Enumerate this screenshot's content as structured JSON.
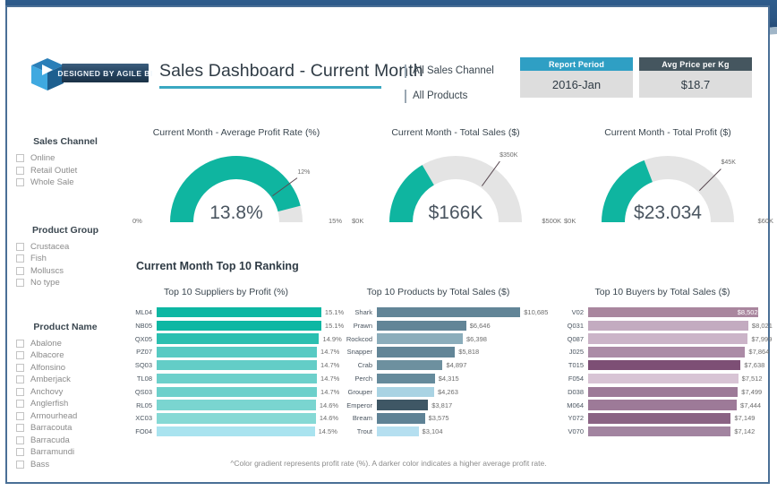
{
  "header": {
    "logo_text": "Designed by Agile BI",
    "logo_icon": "cube-logo-icon",
    "title": "Sales Dashboard - Current Month",
    "slicer_summary": [
      {
        "label": "All Sales Channel"
      },
      {
        "label": "All Products"
      }
    ],
    "kpis": [
      {
        "name": "report-period",
        "label": "Report Period",
        "value": "2016-Jan",
        "header_color": "#2f9fc4"
      },
      {
        "name": "avg-price-per-kg",
        "label": "Avg Price per Kg",
        "value": "$18.7",
        "header_color": "#45565f"
      }
    ]
  },
  "filters": [
    {
      "title": "Sales Channel",
      "items": [
        {
          "label": "Online",
          "checked": false
        },
        {
          "label": "Retail Outlet",
          "checked": false
        },
        {
          "label": "Whole Sale",
          "checked": false
        }
      ]
    },
    {
      "title": "Product Group",
      "items": [
        {
          "label": "Crustacea",
          "checked": false
        },
        {
          "label": "Fish",
          "checked": false
        },
        {
          "label": "Molluscs",
          "checked": false
        },
        {
          "label": "No type",
          "checked": false
        }
      ]
    },
    {
      "title": "Product Name",
      "items": [
        {
          "label": "Abalone",
          "checked": false
        },
        {
          "label": "Albacore",
          "checked": false
        },
        {
          "label": "Alfonsino",
          "checked": false
        },
        {
          "label": "Amberjack",
          "checked": false
        },
        {
          "label": "Anchovy",
          "checked": false
        },
        {
          "label": "Anglerfish",
          "checked": false
        },
        {
          "label": "Armourhead",
          "checked": false
        },
        {
          "label": "Barracouta",
          "checked": false
        },
        {
          "label": "Barracuda",
          "checked": false
        },
        {
          "label": "Barramundi",
          "checked": false
        },
        {
          "label": "Bass",
          "checked": false
        }
      ]
    }
  ],
  "section_title": "Current Month Top 10 Ranking",
  "footnote": "^Color gradient represents profit rate (%). A darker color indicates a higher average profit rate.",
  "colors": {
    "banner": "#2b5480",
    "teal": "#0fb5a0",
    "gauge_track": "#e4e4e4",
    "title_rule": "#3aa8c1",
    "frame": "#4a6f96"
  },
  "chart_data": [
    {
      "type": "gauge",
      "name": "average-profit-rate-gauge",
      "title": "Current Month - Average Profit Rate (%)",
      "value": 13.8,
      "value_label": "13.8%",
      "min": 0,
      "max": 15,
      "min_label": "0%",
      "max_label": "15%",
      "target": 12,
      "target_label": "12%",
      "fill_color": "#0fb5a0",
      "track_color": "#e4e4e4"
    },
    {
      "type": "gauge",
      "name": "total-sales-gauge",
      "title": "Current Month - Total Sales ($)",
      "value": 166,
      "value_label": "$166K",
      "min": 0,
      "max": 500,
      "min_label": "$0K",
      "max_label": "$500K",
      "target": 350,
      "target_label": "$350K",
      "fill_color": "#0fb5a0",
      "track_color": "#e4e4e4"
    },
    {
      "type": "gauge",
      "name": "total-profit-gauge",
      "title": "Current Month - Total Profit ($)",
      "value": 23.034,
      "value_label": "$23.034",
      "min": 0,
      "max": 60,
      "min_label": "$0K",
      "max_label": "$60K",
      "target": 45,
      "target_label": "$45K",
      "fill_color": "#0fb5a0",
      "track_color": "#e4e4e4"
    },
    {
      "type": "bar",
      "name": "top-suppliers-by-profit",
      "title": "Top 10 Suppliers by Profit (%)",
      "orientation": "horizontal",
      "xlabel": "",
      "ylabel": "",
      "axis_max": 15.6,
      "label_inside": false,
      "categories": [
        "ML04",
        "NB05",
        "QX05",
        "PZ07",
        "SQ03",
        "TL08",
        "QS03",
        "RL05",
        "XC03",
        "FO04"
      ],
      "values": [
        15.1,
        15.1,
        14.9,
        14.7,
        14.7,
        14.7,
        14.7,
        14.6,
        14.6,
        14.5
      ],
      "value_labels": [
        "15.1%",
        "15.1%",
        "14.9%",
        "14.7%",
        "14.7%",
        "14.7%",
        "14.7%",
        "14.6%",
        "14.6%",
        "14.5%"
      ],
      "bar_colors": [
        "#0db7a3",
        "#0db7a3",
        "#2bbfb0",
        "#57cac3",
        "#63cdc7",
        "#6dd0cb",
        "#6dd0cb",
        "#7ad5d0",
        "#86d9d5",
        "#a9e3ef"
      ]
    },
    {
      "type": "bar",
      "name": "top-products-by-total-sales",
      "title": "Top 10 Products by Total Sales ($)",
      "orientation": "horizontal",
      "xlabel": "",
      "ylabel": "",
      "axis_max": 12400,
      "label_inside": false,
      "categories": [
        "Shark",
        "Prawn",
        "Rockcod",
        "Snapper",
        "Crab",
        "Perch",
        "Grouper",
        "Emperor",
        "Bream",
        "Trout"
      ],
      "values": [
        10685,
        6646,
        6398,
        5818,
        4897,
        4315,
        4263,
        3817,
        3575,
        3104
      ],
      "value_labels": [
        "$10,685",
        "$6,646",
        "$6,398",
        "$5,818",
        "$4,897",
        "$4,315",
        "$4,263",
        "$3,817",
        "$3,575",
        "$3,104"
      ],
      "bar_colors": [
        "#628597",
        "#628597",
        "#8badbb",
        "#628597",
        "#6d909f",
        "#658a9b",
        "#a9d3e3",
        "#3f5765",
        "#5e8295",
        "#b5dff0"
      ]
    },
    {
      "type": "bar",
      "name": "top-buyers-by-total-sales",
      "title": "Top 10 Buyers by Total Sales ($)",
      "orientation": "horizontal",
      "xlabel": "",
      "ylabel": "",
      "axis_max": 9100,
      "label_inside": false,
      "categories": [
        "V02",
        "Q031",
        "Q087",
        "J025",
        "T015",
        "F054",
        "D038",
        "M064",
        "Y072",
        "V070"
      ],
      "values": [
        8502,
        8021,
        7999,
        7864,
        7638,
        7512,
        7499,
        7444,
        7149,
        7142
      ],
      "value_labels": [
        "$8,502",
        "$8,021",
        "$7,999",
        "$7,864",
        "$7,638",
        "$7,512",
        "$7,499",
        "$7,444",
        "$7,149",
        "$7,142"
      ],
      "label_positions": [
        "inside",
        "outside",
        "outside",
        "outside",
        "outside",
        "outside",
        "outside",
        "outside",
        "outside",
        "outside"
      ],
      "bar_colors": [
        "#a9869e",
        "#c3abc0",
        "#cbb4c8",
        "#ab8ba6",
        "#7d4f75",
        "#d8c4d5",
        "#9d7a98",
        "#9d7a98",
        "#8a6384",
        "#a284a0"
      ]
    }
  ]
}
